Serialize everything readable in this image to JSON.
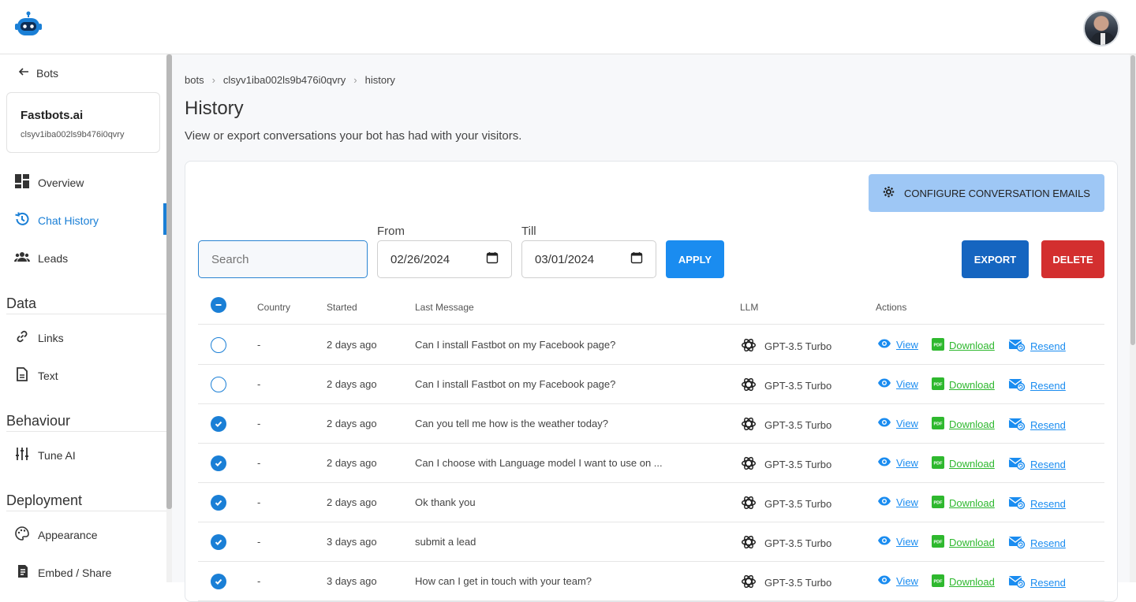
{
  "nav_back": "Bots",
  "bot": {
    "name": "Fastbots.ai",
    "id": "clsyv1iba002ls9b476i0qvry"
  },
  "sidebar": {
    "items": [
      {
        "label": "Overview",
        "icon": "dashboard-icon"
      },
      {
        "label": "Chat History",
        "icon": "history-icon",
        "active": true
      },
      {
        "label": "Leads",
        "icon": "people-icon"
      }
    ],
    "sections": [
      {
        "title": "Data",
        "items": [
          {
            "label": "Links",
            "icon": "link-icon"
          },
          {
            "label": "Text",
            "icon": "document-icon"
          }
        ]
      },
      {
        "title": "Behaviour",
        "items": [
          {
            "label": "Tune AI",
            "icon": "sliders-icon"
          }
        ]
      },
      {
        "title": "Deployment",
        "items": [
          {
            "label": "Appearance",
            "icon": "palette-icon"
          },
          {
            "label": "Embed / Share",
            "icon": "embed-icon"
          }
        ]
      }
    ]
  },
  "breadcrumb": [
    "bots",
    "clsyv1iba002ls9b476i0qvry",
    "history"
  ],
  "page": {
    "title": "History",
    "subtitle": "View or export conversations your bot has had with your visitors."
  },
  "toolbar": {
    "configure_label": "Configure Conversation Emails",
    "search_placeholder": "Search",
    "from_label": "From",
    "from_value": "02/26/2024",
    "till_label": "Till",
    "till_value": "03/01/2024",
    "apply_label": "Apply",
    "export_label": "Export",
    "delete_label": "Delete"
  },
  "table": {
    "headers": [
      "Country",
      "Started",
      "Last Message",
      "LLM",
      "Actions"
    ],
    "action_labels": {
      "view": "View",
      "download": "Download",
      "resend": "Resend"
    },
    "rows": [
      {
        "checked": false,
        "country": "-",
        "started": "2 days ago",
        "last_message": "Can I install Fastbot on my Facebook page?",
        "llm": "GPT-3.5 Turbo"
      },
      {
        "checked": false,
        "country": "-",
        "started": "2 days ago",
        "last_message": "Can I install Fastbot on my Facebook page?",
        "llm": "GPT-3.5 Turbo"
      },
      {
        "checked": true,
        "country": "-",
        "started": "2 days ago",
        "last_message": "Can you tell me how is the weather today?",
        "llm": "GPT-3.5 Turbo"
      },
      {
        "checked": true,
        "country": "-",
        "started": "2 days ago",
        "last_message": "Can I choose with Language model I want to use on ...",
        "llm": "GPT-3.5 Turbo"
      },
      {
        "checked": true,
        "country": "-",
        "started": "2 days ago",
        "last_message": "Ok thank you",
        "llm": "GPT-3.5 Turbo"
      },
      {
        "checked": true,
        "country": "-",
        "started": "3 days ago",
        "last_message": "submit a lead",
        "llm": "GPT-3.5 Turbo"
      },
      {
        "checked": true,
        "country": "-",
        "started": "3 days ago",
        "last_message": "How can I get in touch with your team?",
        "llm": "GPT-3.5 Turbo"
      }
    ]
  },
  "colors": {
    "accent": "#1a7fd6",
    "export": "#1565c0",
    "delete": "#d32f2f",
    "configure": "#9ec7f5",
    "pdf": "#2eb82e"
  }
}
